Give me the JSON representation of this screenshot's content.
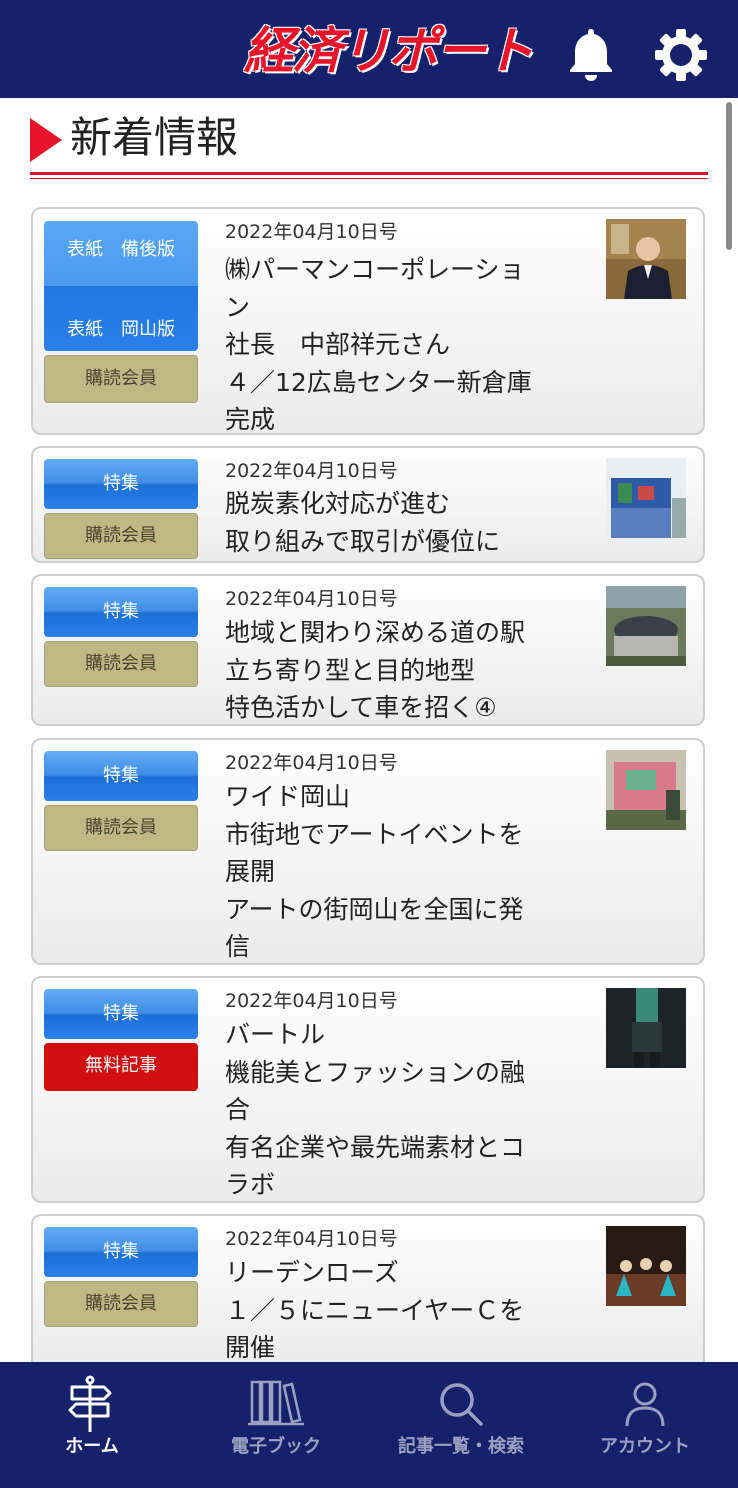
{
  "app": {
    "title": "経済リポート"
  },
  "header": {
    "bell_icon": "bell-icon",
    "gear_icon": "gear-icon"
  },
  "section": {
    "title": "新着情報"
  },
  "articles": [
    {
      "tags": [
        "表紙　備後版",
        "表紙　岡山版",
        "購読会員"
      ],
      "date": "2022年04月10日号",
      "lines": [
        "㈱パーマンコーポレーショ",
        "ン",
        "社長　中部祥元さん",
        "４／12広島センター新倉庫",
        "完成"
      ]
    },
    {
      "tags": [
        "特集",
        "購読会員"
      ],
      "date": "2022年04月10日号",
      "lines": [
        "脱炭素化対応が進む",
        "取り組みで取引が優位に"
      ]
    },
    {
      "tags": [
        "特集",
        "購読会員"
      ],
      "date": "2022年04月10日号",
      "lines": [
        "地域と関わり深める道の駅",
        "立ち寄り型と目的地型",
        "特色活かして車を招く④"
      ]
    },
    {
      "tags": [
        "特集",
        "購読会員"
      ],
      "date": "2022年04月10日号",
      "lines": [
        "ワイド岡山",
        "市街地でアートイベントを",
        "展開",
        "アートの街岡山を全国に発",
        "信"
      ]
    },
    {
      "tags": [
        "特集",
        "無料記事"
      ],
      "date": "2022年04月10日号",
      "lines": [
        "バートル",
        "機能美とファッションの融",
        "合",
        "有名企業や最先端素材とコ",
        "ラボ"
      ]
    },
    {
      "tags": [
        "特集",
        "購読会員"
      ],
      "date": "2022年04月10日号",
      "lines": [
        "リーデンローズ",
        "１／５にニューイヤーＣを",
        "開催"
      ]
    }
  ],
  "nav": {
    "items": [
      {
        "label": "ホーム",
        "icon": "signpost-icon",
        "active": true
      },
      {
        "label": "電子ブック",
        "icon": "books-icon",
        "active": false
      },
      {
        "label": "記事一覧・検索",
        "icon": "search-icon",
        "active": false
      },
      {
        "label": "アカウント",
        "icon": "person-icon",
        "active": false
      }
    ]
  },
  "colors": {
    "header_bg": "#16216b",
    "accent_red": "#e8142a",
    "tag_blue": "#2a7fe8",
    "tag_olive": "#bfb884",
    "tag_red": "#d20f0f"
  }
}
